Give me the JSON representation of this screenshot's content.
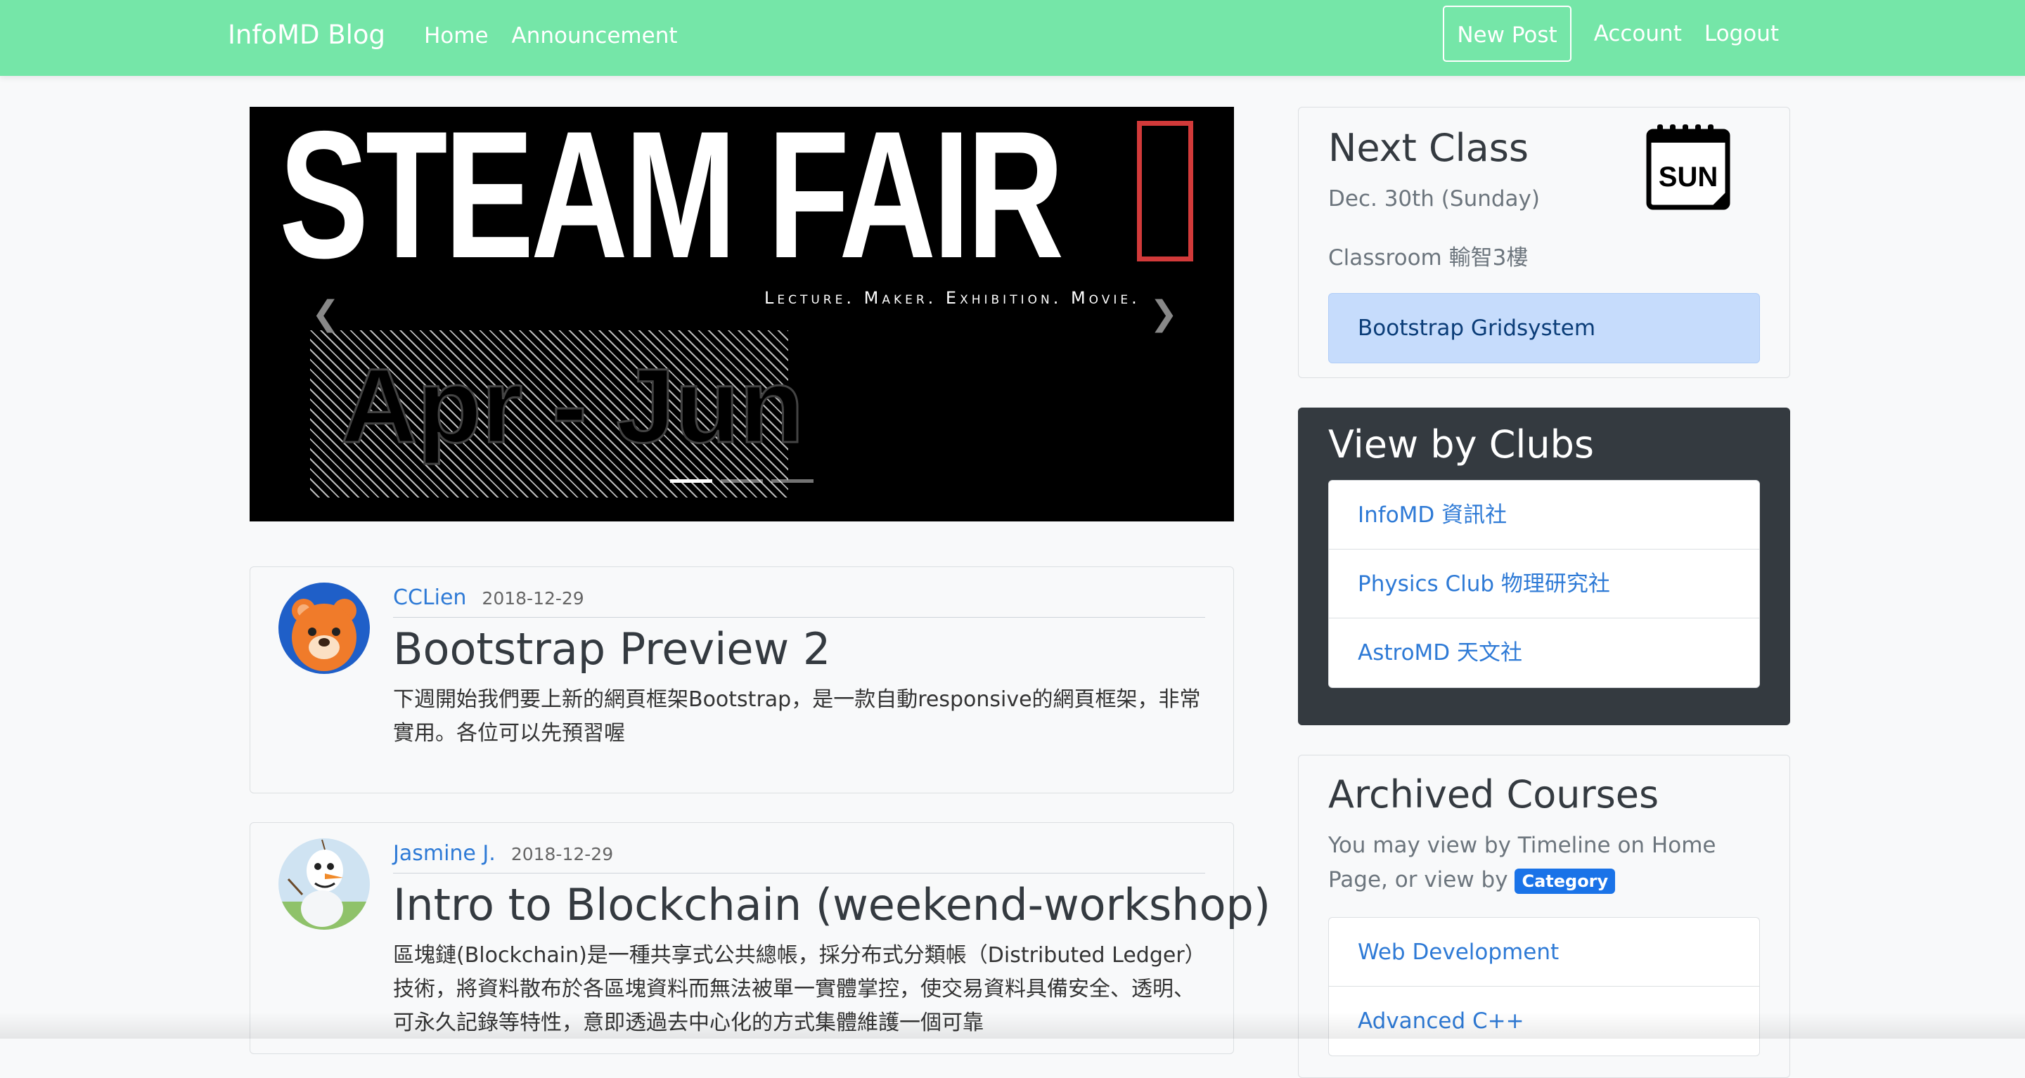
{
  "nav": {
    "brand": "InfoMD Blog",
    "links": [
      "Home",
      "Announcement"
    ],
    "new_post": "New Post",
    "account": "Account",
    "logout": "Logout"
  },
  "carousel": {
    "title": "STEAM FAIR",
    "subtitle": "Lecture. Maker. Exhibition. Movie.",
    "dates": "Apr - Jun",
    "slide_count": 3,
    "active_index": 0
  },
  "posts": [
    {
      "author": "CCLien",
      "date": "2018-12-29",
      "title": "Bootstrap Preview 2",
      "text": "下週開始我們要上新的網頁框架Bootstrap，是一款自動responsive的網頁框架，非常實用。各位可以先預習喔"
    },
    {
      "author": "Jasmine J.",
      "date": "2018-12-29",
      "title": "Intro to Blockchain (weekend-workshop)",
      "text": "區塊鏈(Blockchain)是一種共享式公共總帳，採分布式分類帳（Distributed Ledger）技術，將資料散布於各區塊資料而無法被單一實體掌控，使交易資料具備安全、透明、可永久記錄等特性，意即透過去中心化的方式集體維護一個可靠"
    }
  ],
  "next_class": {
    "title": "Next Class",
    "date": "Dec. 30th (Sunday)",
    "classroom": "Classroom 輸智3樓",
    "topic": "Bootstrap Gridsystem",
    "calendar_day": "SUN"
  },
  "clubs": {
    "title": "View by Clubs",
    "items": [
      "InfoMD 資訊社",
      "Physics Club 物理研究社",
      "AstroMD 天文社"
    ]
  },
  "archived": {
    "title": "Archived Courses",
    "desc_1": "You may view by Timeline on Home Page, or view by",
    "badge": "Category",
    "items": [
      "Web Development",
      "Advanced C++"
    ]
  },
  "colors": {
    "navbar": "#75e6a8",
    "link": "#2e7ad6",
    "badge": "#1a73e8",
    "clubs_bg": "#343a40",
    "topic_bg": "#c6dcfc"
  }
}
